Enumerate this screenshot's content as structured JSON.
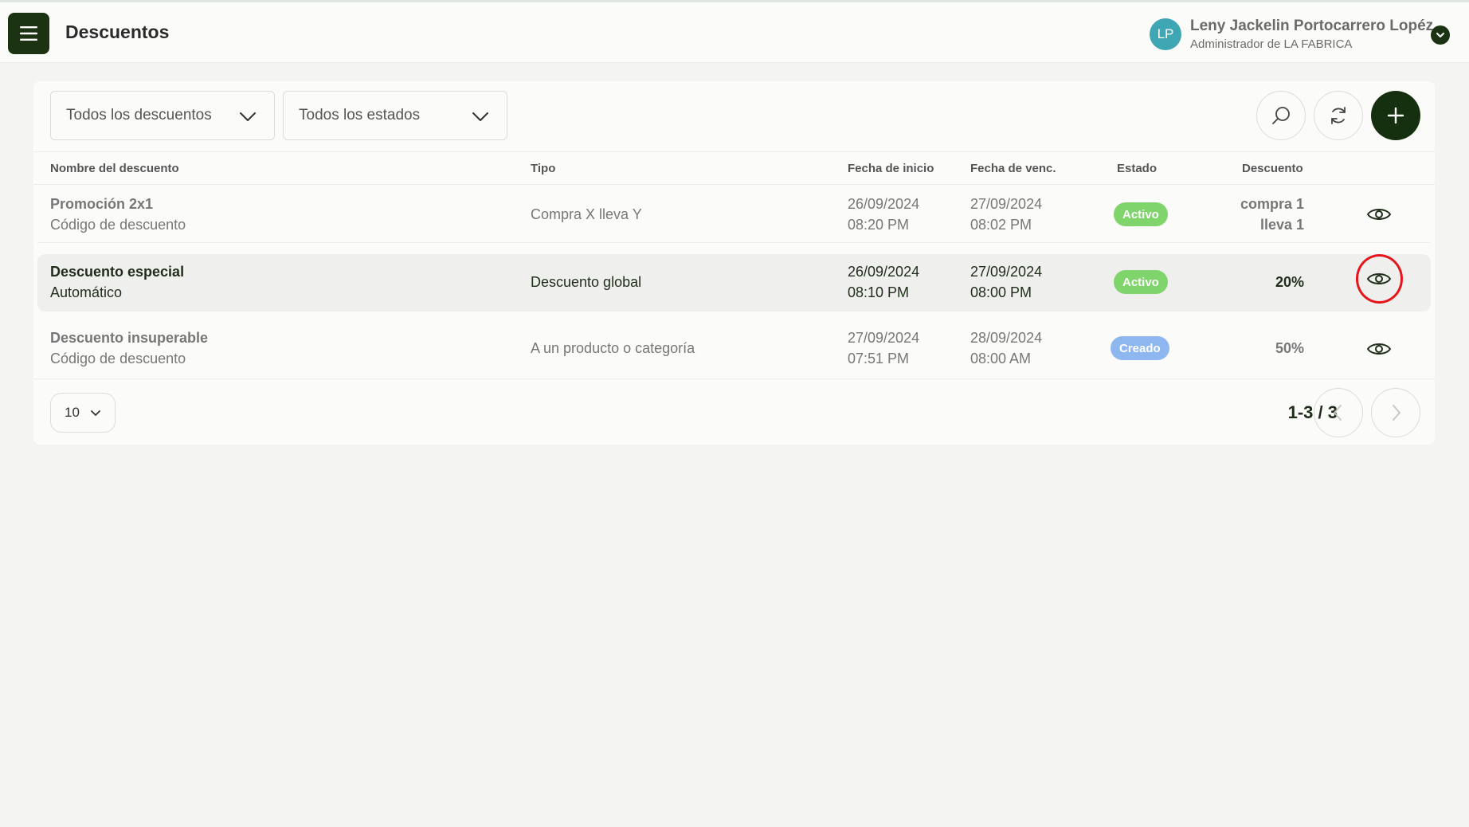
{
  "header": {
    "title": "Descuentos",
    "user": {
      "initials": "LP",
      "name": "Leny Jackelin Portocarrero Lopéz",
      "role": "Administrador de LA FABRICA"
    }
  },
  "filters": {
    "discount_filter": "Todos los descuentos",
    "status_filter": "Todos los estados"
  },
  "table": {
    "columns": [
      "Nombre del descuento",
      "Tipo",
      "Fecha de inicio",
      "Fecha de venc.",
      "Estado",
      "Descuento"
    ],
    "rows": [
      {
        "name": "Promoción 2x1",
        "method": "Código de descuento",
        "type": "Compra X lleva Y",
        "start_date": "26/09/2024",
        "start_time": "08:20 PM",
        "end_date": "27/09/2024",
        "end_time": "08:02 PM",
        "status": "Activo",
        "discount_line1": "compra 1",
        "discount_line2": "lleva 1"
      },
      {
        "name": "Descuento especial",
        "method": "Automático",
        "type": "Descuento global",
        "start_date": "26/09/2024",
        "start_time": "08:10 PM",
        "end_date": "27/09/2024",
        "end_time": "08:00 PM",
        "status": "Activo",
        "discount_line1": "20%",
        "discount_line2": ""
      },
      {
        "name": "Descuento insuperable",
        "method": "Código de descuento",
        "type": "A un producto o categoría",
        "start_date": "27/09/2024",
        "start_time": "07:51 PM",
        "end_date": "28/09/2024",
        "end_time": "08:00 AM",
        "status": "Creado",
        "discount_line1": "50%",
        "discount_line2": ""
      }
    ]
  },
  "pagination": {
    "page_size": "10",
    "range": "1-3 / 3"
  },
  "colors": {
    "brand_dark": "#1b3312",
    "status_active": "#7fd46b",
    "status_created": "#8fb7ef",
    "avatar": "#3fa6b3",
    "highlight_ring": "#e6141b"
  },
  "icons": {
    "menu": "hamburger-icon",
    "user_dropdown": "chevron-down-icon",
    "search": "search-icon",
    "refresh": "refresh-icon",
    "add": "plus-icon",
    "view": "eye-icon",
    "prev": "chevron-left-icon",
    "next": "chevron-right-icon"
  }
}
